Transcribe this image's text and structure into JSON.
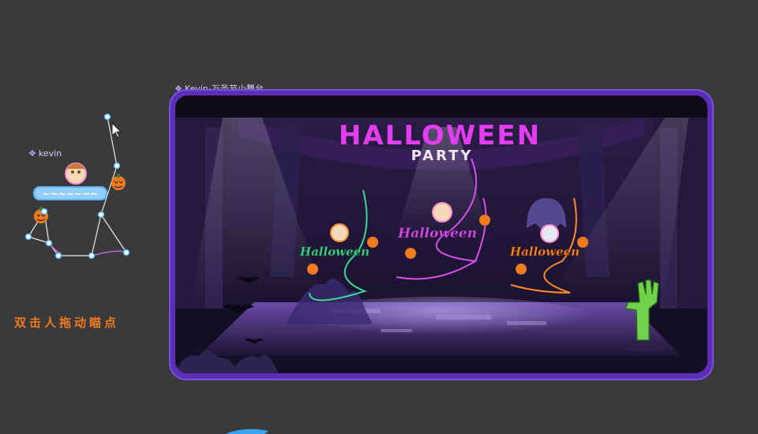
{
  "frame": {
    "label": "Kevin-万圣节小舞台"
  },
  "component": {
    "label": "kevin"
  },
  "hint": {
    "text": "双击人拖动瞄点"
  },
  "stage": {
    "title_line1": "HALLOWEEN",
    "title_line2": "PARTY",
    "puppets": [
      {
        "tag": "Halloween",
        "color": "#3fd78f"
      },
      {
        "tag": "Halloween",
        "color": "#d850e8"
      },
      {
        "tag": "Halloween",
        "color": "#ff8a2a"
      }
    ]
  },
  "colors": {
    "canvas_bg": "#3a3a3a",
    "frame_border": "#5a2fb5",
    "label": "#d8cdfc",
    "hint": "#f07a1e",
    "title_pink": "#e23df0",
    "anchor": "#4fb3f5"
  },
  "icons": [
    "cursor-arrow-icon",
    "component-diamond-icon",
    "pumpkin-icon",
    "zombie-hand-icon",
    "bat-icon",
    "ghost-icon"
  ]
}
